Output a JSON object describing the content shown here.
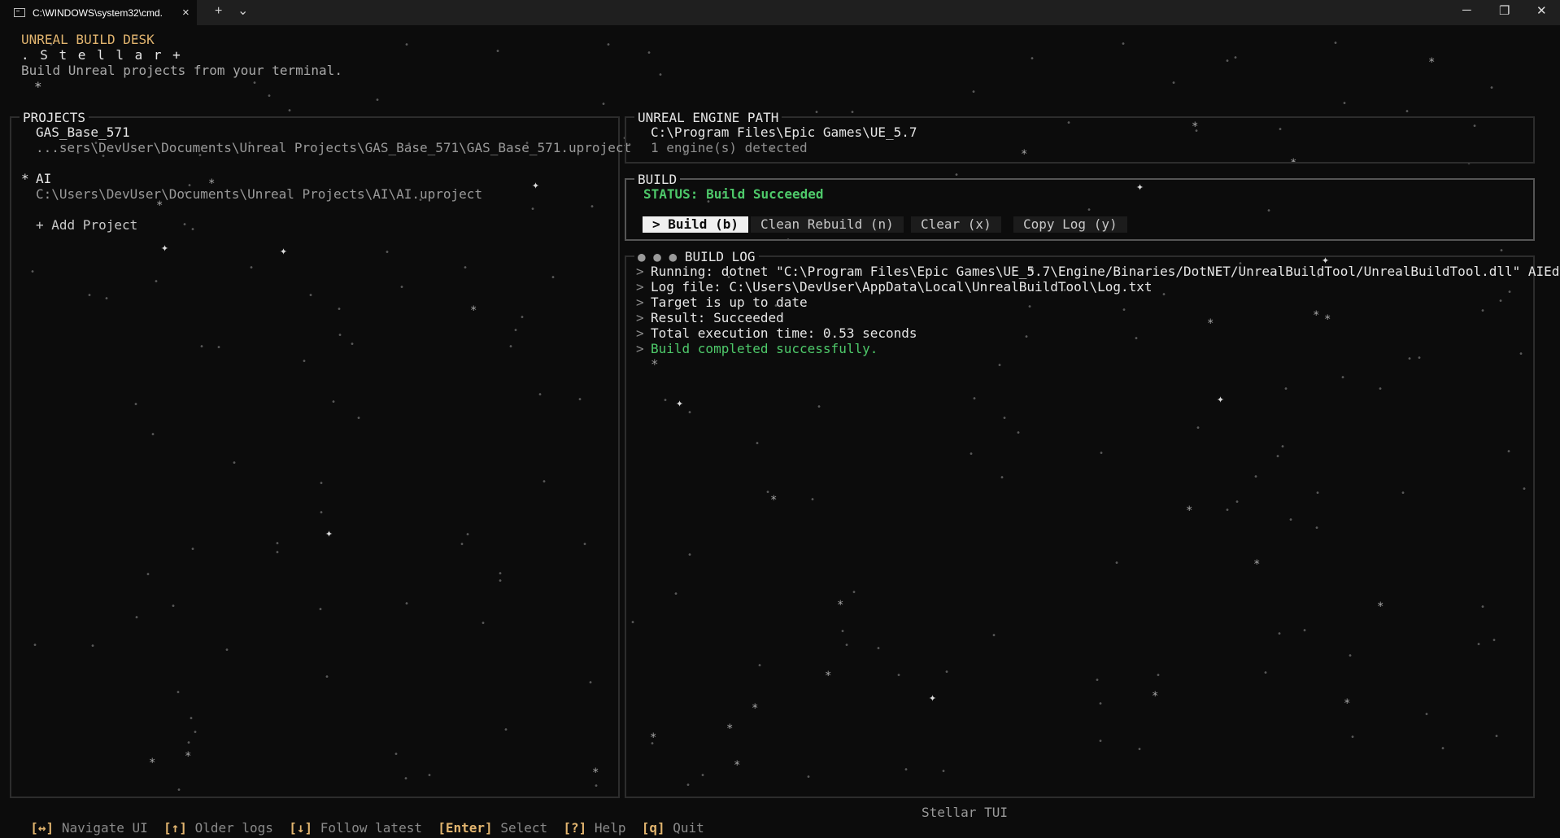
{
  "window": {
    "tab_title": "C:\\WINDOWS\\system32\\cmd.",
    "tab_close": "×",
    "new_tab": "+",
    "dropdown": "⌄",
    "minimize": "─",
    "maximize": "❐",
    "close": "✕"
  },
  "header": {
    "title": "UNREAL BUILD DESK",
    "logo": ". S t e l l a r +",
    "tagline": "Build Unreal projects from your terminal.",
    "logo_star": "*"
  },
  "projects": {
    "title": "PROJECTS",
    "items": [
      {
        "marker": "",
        "name": "GAS_Base_571",
        "path": "...sers\\DevUser\\Documents\\Unreal Projects\\GAS_Base_571\\GAS_Base_571.uproject"
      },
      {
        "marker": "*",
        "name": "AI",
        "path": "C:\\Users\\DevUser\\Documents\\Unreal Projects\\AI\\AI.uproject"
      }
    ],
    "add_label": "+ Add Project"
  },
  "engine": {
    "title": "UNREAL ENGINE PATH",
    "path": "C:\\Program Files\\Epic Games\\UE_5.7",
    "detected": "1 engine(s) detected"
  },
  "build": {
    "title": "BUILD",
    "status": "STATUS: Build Succeeded",
    "buttons": {
      "build": "> Build (b)",
      "rebuild": "Clean Rebuild (n)",
      "clear": "Clear (x)",
      "copy": "Copy Log (y)"
    }
  },
  "log": {
    "title": "BUILD LOG",
    "dots": "● ● ●",
    "prompt": ">",
    "lines": [
      "Running: dotnet \"C:\\Program Files\\Epic Games\\UE_5.7\\Engine/Binaries/DotNET/UnrealBuildTool/UnrealBuildTool.dll\" AIEditor",
      "Log file: C:\\Users\\DevUser\\AppData\\Local\\UnrealBuildTool\\Log.txt",
      "Target is up to date",
      "Result: Succeeded",
      "Total execution time: 0.53 seconds",
      "Build completed successfully."
    ],
    "cursor": "*"
  },
  "footer": {
    "hints": [
      {
        "key": "[↔]",
        "label": "Navigate UI"
      },
      {
        "key": "[↑]",
        "label": "Older logs"
      },
      {
        "key": "[↓]",
        "label": "Follow latest"
      },
      {
        "key": "[Enter]",
        "label": "Select"
      },
      {
        "key": "[?]",
        "label": "Help"
      },
      {
        "key": "[q]",
        "label": "Quit"
      }
    ],
    "app_name": "Stellar TUI"
  },
  "colors": {
    "background": "#0c0c0c",
    "accent": "#e2b56f",
    "success": "#4ec96a",
    "text": "#cccccc"
  }
}
